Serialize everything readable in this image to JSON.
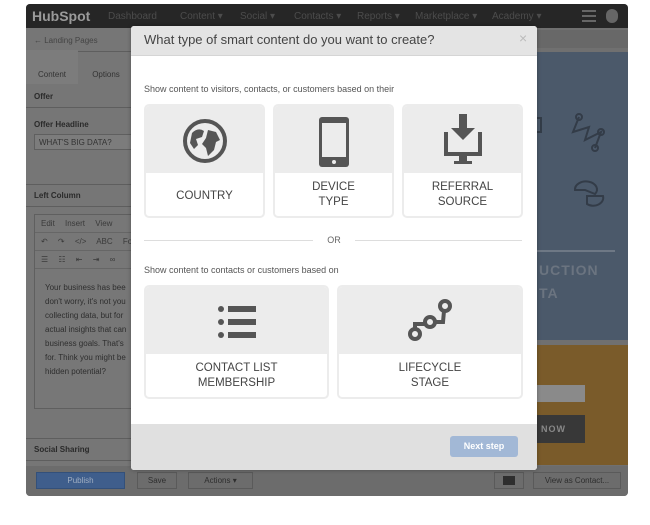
{
  "nav": {
    "logo": "HubSpot",
    "items": [
      "Dashboard",
      "Content ▾",
      "Social ▾",
      "Contacts ▾",
      "Reports ▾",
      "Marketplace ▾",
      "Academy ▾"
    ]
  },
  "left": {
    "back": "← Landing Pages",
    "tabs": [
      "Content",
      "Options"
    ],
    "offer": "Offer",
    "offer_headline_label": "Offer Headline",
    "offer_headline_value": "WHAT'S BIG DATA?",
    "left_column": "Left Column",
    "editor_menu": "Edit Insert View",
    "editor_toolbar1": "↶ ↷ </> ABC Form",
    "editor_toolbar2": "☰ ☷ ⇤ ⇥ ∞",
    "editor_text": [
      "Your business has bee",
      "don't worry, it's not you",
      "collecting data, but for",
      "actual insights that can",
      "business goals. That's",
      "for. Think you might be",
      "hidden potential?"
    ],
    "social_sharing": "Social Sharing"
  },
  "preview": {
    "heading1": "UCTION",
    "heading2": "TA",
    "cta": "NOW",
    "colors": {
      "hero": "#4b596a",
      "cta_band": "#7a5b2a"
    }
  },
  "bottom": {
    "publish": "Publish",
    "save": "Save",
    "actions": "Actions ▾",
    "view_as": "View as Contact..."
  },
  "modal": {
    "title": "What type of smart content do you want to create?",
    "close": "×",
    "section1": "Show content to visitors, contacts, or customers based on their",
    "cards1": [
      {
        "line1": "COUNTRY",
        "line2": "",
        "icon": "globe-icon"
      },
      {
        "line1": "DEVICE",
        "line2": "TYPE",
        "icon": "phone-icon"
      },
      {
        "line1": "REFERRAL",
        "line2": "SOURCE",
        "icon": "download-monitor-icon"
      }
    ],
    "or": "OR",
    "section2": "Show content to contacts or customers based on",
    "cards2": [
      {
        "line1": "CONTACT LIST",
        "line2": "MEMBERSHIP",
        "icon": "list-icon"
      },
      {
        "line1": "LIFECYCLE",
        "line2": "STAGE",
        "icon": "lifecycle-icon"
      }
    ],
    "next": "Next step"
  }
}
